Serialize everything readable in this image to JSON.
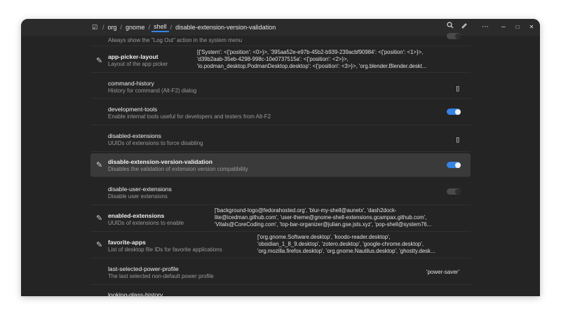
{
  "header": {
    "path": [
      "org",
      "gnome",
      "shell",
      "disable-extension-version-validation"
    ],
    "separator": "/",
    "search_icon": "search-icon",
    "menu_icon": "more-horiz-icon",
    "minimize": "–",
    "maximize": "□",
    "close": "✕"
  },
  "rows": {
    "always_show_logout": {
      "desc": "Always show the \"Log Out\" action in the system menu"
    },
    "app_picker_layout": {
      "name": "app-picker-layout",
      "desc": "Layout of the app picker",
      "value_line1": "[{'System': <{'position': <0>}>, '395aa52e-e97b-45b2-b939-239acbf90984': <{'position': <1>}>,",
      "value_line2": "'d39b2aab-35eb-4298-998c-10e0737515a': <{'position': <2>}>,",
      "value_line3": "'io.podman_desktop.PodmanDesktop.desktop': <{'position': <3>}>, 'org.blender.Blender.deskt..."
    },
    "command_history": {
      "name": "command-history",
      "desc": "History for command (Alt-F2) dialog",
      "value": "[]"
    },
    "development_tools": {
      "name": "development-tools",
      "desc": "Enable internal tools useful for developers and testers from Alt-F2",
      "toggle": true
    },
    "disabled_extensions": {
      "name": "disabled-extensions",
      "desc": "UUIDs of extensions to force disabling",
      "value": "[]"
    },
    "disable_ext_validation": {
      "name": "disable-extension-version-validation",
      "desc": "Disables the validation of extension version compatibility",
      "toggle": true
    },
    "disable_user_extensions": {
      "name": "disable-user-extensions",
      "desc": "Disable user extensions",
      "toggle": false
    },
    "enabled_extensions": {
      "name": "enabled-extensions",
      "desc": "UUIDs of extensions to enable",
      "value_line1": "['background-logo@fedorahosted.org', 'blur-my-shell@aunetx', 'dash2dock-",
      "value_line2": "lite@icedman.github.com', 'user-theme@gnome-shell-extensions.gcampax.github.com',",
      "value_line3": "'Vitals@CoreCoding.com', 'top-bar-organizer@julian.gse.jsts.xyz', 'pop-shell@system76..."
    },
    "favorite_apps": {
      "name": "favorite-apps",
      "desc": "List of desktop file IDs for favorite applications",
      "value_line1": "['org.gnome.Software.desktop', 'koodo-reader.desktop',",
      "value_line2": "'obsidian_1_8_9.desktop', 'zotero.desktop', 'google-chrome.desktop',",
      "value_line3": "'org.mozilla.firefox.desktop', 'org.gnome.Nautilus.desktop', 'ghostty.desk..."
    },
    "last_power_profile": {
      "name": "last-selected-power-profile",
      "desc": "The last selected non-default power profile",
      "value": "'power-saver'"
    },
    "looking_glass_history": {
      "name": "looking-glass-history"
    }
  }
}
